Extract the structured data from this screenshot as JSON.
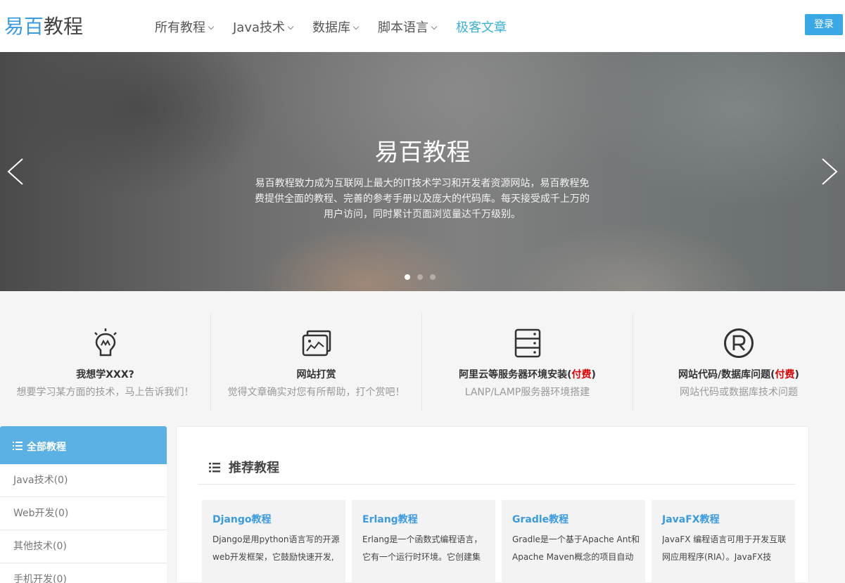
{
  "header": {
    "logo_part1": "易百",
    "logo_part2": "教程",
    "nav": [
      {
        "label": "所有教程"
      },
      {
        "label": "Java技术"
      },
      {
        "label": "数据库"
      },
      {
        "label": "脚本语言"
      },
      {
        "label": "极客文章"
      }
    ],
    "login_label": "登录"
  },
  "banner": {
    "title": "易百教程",
    "description": "易百教程致力成为互联网上最大的IT技术学习和开发者资源网站，易百教程免费提供全面的教程、完善的参考手册以及庞大的代码库。每天接受成千上万的用户访问，同时累计页面浏览量达千万级别。",
    "active_slide": 1,
    "slide_count": 3
  },
  "features": [
    {
      "icon": "lightbulb-icon",
      "title": "我想学XXX?",
      "paid_mark": "",
      "title_end": "",
      "subtitle": "想要学习某方面的技术，马上告诉我们！"
    },
    {
      "icon": "picture-frame-icon",
      "title": "网站打赏",
      "paid_mark": "",
      "title_end": "",
      "subtitle": "觉得文章确实对您有所帮助，打个赏吧！"
    },
    {
      "icon": "server-icon",
      "title": "阿里云等服务器环境安装(",
      "paid_mark": "付费",
      "title_end": ")",
      "subtitle": "LANP/LAMP服务器环境搭建"
    },
    {
      "icon": "registered-icon",
      "title": "网站代码/数据库问题(",
      "paid_mark": "付费",
      "title_end": ")",
      "subtitle": "网站代码或数据库技术问题"
    }
  ],
  "sidebar": {
    "header": "全部教程",
    "items": [
      {
        "label": "Java技术(0)"
      },
      {
        "label": "Web开发(0)"
      },
      {
        "label": "其他技术(0)"
      },
      {
        "label": "手机开发(0)"
      }
    ]
  },
  "main": {
    "title": "推荐教程",
    "cards": [
      {
        "title": "Django教程",
        "desc": "Django是用python语言写的开源web开发框架，它鼓励快速开发,"
      },
      {
        "title": "Erlang教程",
        "desc": "Erlang是一个函数式编程语言，它有一个运行时环境。它创建集"
      },
      {
        "title": "Gradle教程",
        "desc": "Gradle是一个基于Apache Ant和Apache Maven概念的项目自动"
      },
      {
        "title": "JavaFX教程",
        "desc": "JavaFX 编程语言可用于开发互联网应用程序(RIA）。JavaFX技"
      }
    ]
  },
  "colors": {
    "brand_blue": "#3b9be0",
    "login_bg": "#3ba8e6",
    "sidebar_head": "#5bb1e3",
    "paid_red": "#dd0000"
  }
}
